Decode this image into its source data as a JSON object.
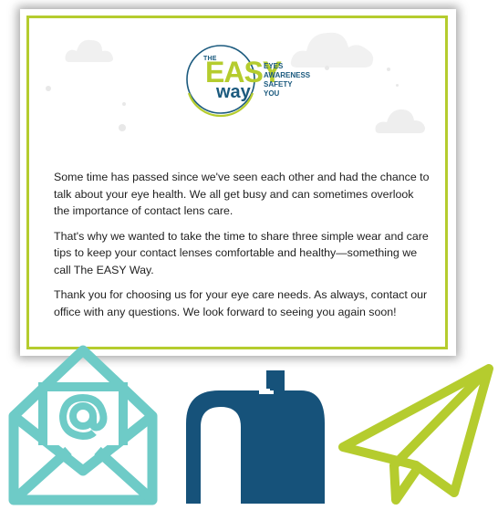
{
  "logo": {
    "the": "THE",
    "easy": "EASY",
    "way": "way",
    "acrostic": [
      "EYES",
      "AWARENESS",
      "SAFETY",
      "YOU"
    ]
  },
  "paragraphs": [
    "Some time has passed since we've seen each other and had the chance to talk about your eye health. We all get busy and can sometimes overlook the importance of contact lens care.",
    "That's why we wanted to take the time to share three simple wear and care tips to keep your contact lenses comfortable and healthy—something we call The EASY Way.",
    "Thank you for choosing us for your eye care needs. As always, contact our office with any questions. We look forward to seeing you again soon!"
  ],
  "colors": {
    "lime": "#b5cc2e",
    "navy": "#1b5a7e",
    "teal": "#6ecbc7"
  },
  "icons": [
    "email-envelope-icon",
    "mailbox-icon",
    "paper-plane-icon"
  ]
}
